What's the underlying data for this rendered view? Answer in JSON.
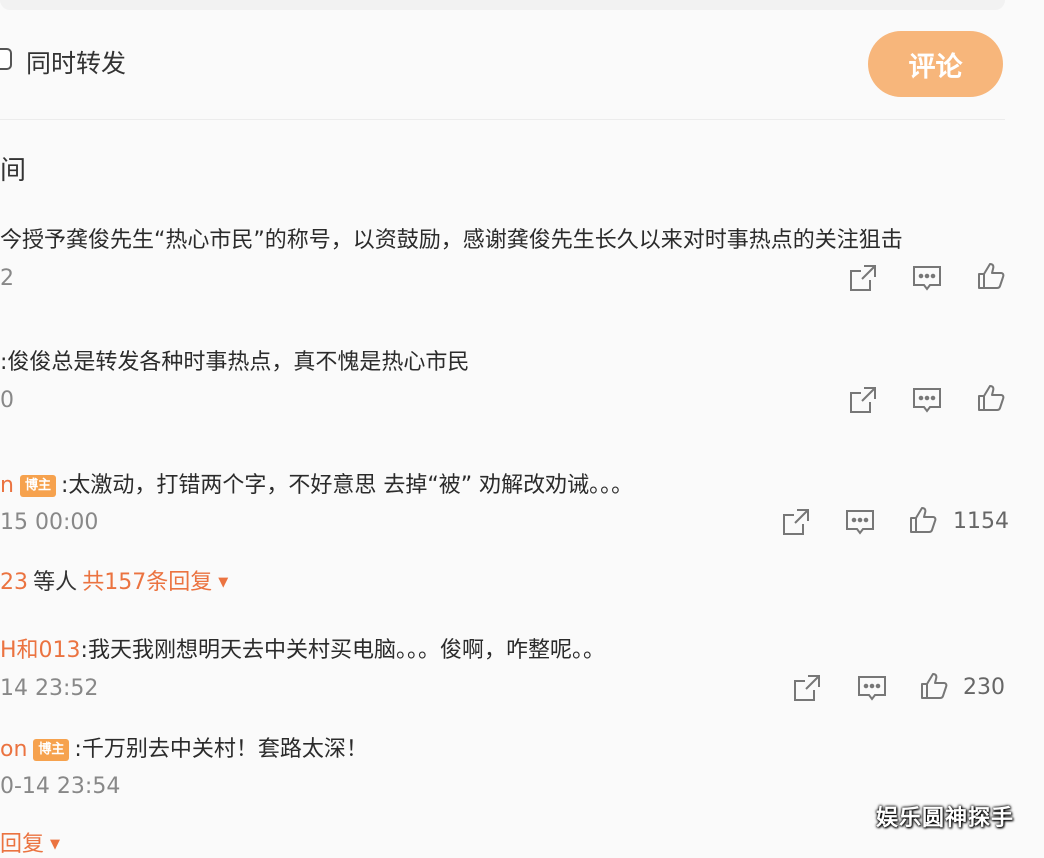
{
  "composer": {
    "repost_label": "同时转发",
    "comment_button": "评论"
  },
  "sort_label": "间",
  "comments": [
    {
      "text": "今授予龚俊先生“热心市民”的称号，以资鼓励，感谢龚俊先生长久以来对时事热点的关注狙击",
      "meta": "2"
    },
    {
      "text": ":俊俊总是转发各种时事热点，真不愧是热心市民",
      "meta": "0"
    },
    {
      "name": "n",
      "badge": "博主",
      "text": ":太激动，打错两个字，不好意思 去掉“被” 劝解改劝诫。。。",
      "meta": "15 00:00",
      "likes": "1154",
      "reply_prefix": "23",
      "reply_mid": "等人",
      "reply_total": "共157条回复"
    },
    {
      "name": "H和013",
      "text": ":我天我刚想明天去中关村买电脑。。。俊啊，咋整呢。。",
      "meta": "14 23:52",
      "likes": "230"
    },
    {
      "name": "on",
      "badge": "博主",
      "text": ":千万别去中关村！套路太深！",
      "meta": "0-14 23:54",
      "reply_more": "回复"
    }
  ],
  "watermark": "娱乐圆神探手",
  "colors": {
    "accent": "#eb7340",
    "button": "#f7b67b",
    "badge": "#f6a24e"
  },
  "icons": [
    "share-icon",
    "comment-icon",
    "like-icon"
  ]
}
